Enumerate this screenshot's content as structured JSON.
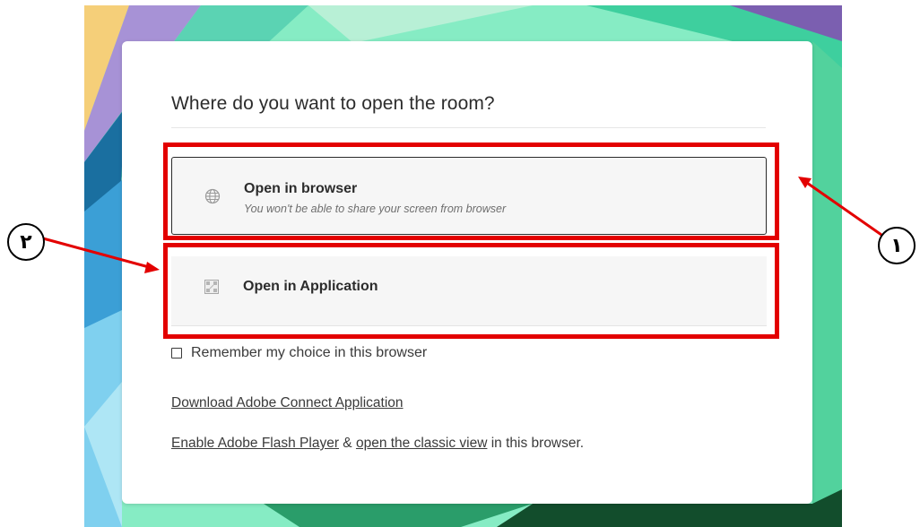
{
  "dialog": {
    "title": "Where do you want to open the room?",
    "options": [
      {
        "label": "Open in browser",
        "subtitle": "You won't be able to share your screen from browser",
        "icon": "globe-icon"
      },
      {
        "label": "Open in Application",
        "icon": "application-icon"
      }
    ],
    "remember": {
      "label": "Remember my choice in this browser",
      "checked": false
    },
    "download_link": "Download Adobe Connect Application",
    "flash_line": {
      "link1": "Enable Adobe Flash Player",
      "connector": "&",
      "link2": "open the classic view",
      "suffix": "in this browser."
    }
  },
  "annotations": {
    "marker1": "۱",
    "marker2": "۲",
    "color": "#e30000"
  }
}
